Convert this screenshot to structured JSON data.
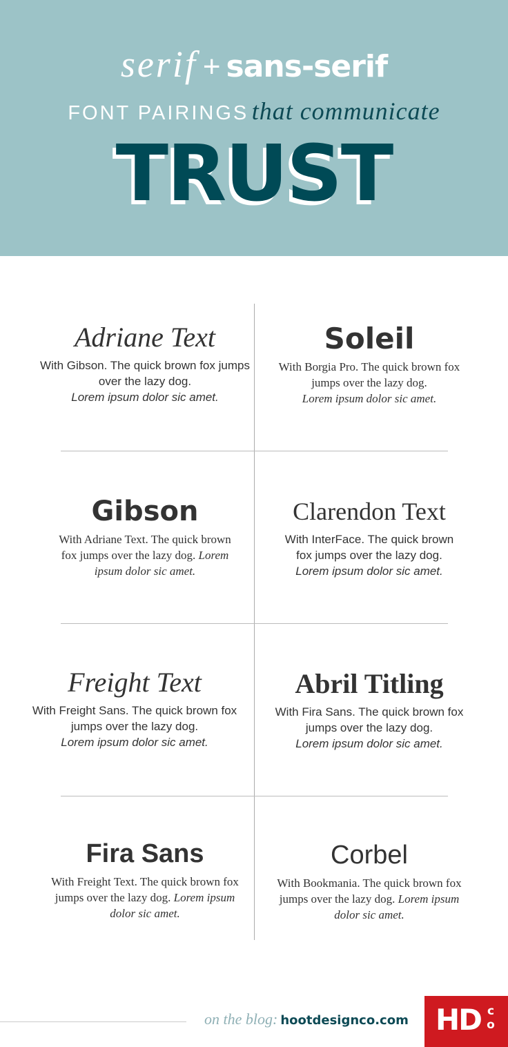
{
  "header": {
    "serif_word": "serif",
    "plus": "+",
    "sans_word": "sans-serif",
    "caps": "FONT PAIRINGS",
    "italic": "that communicate",
    "big": "TRUST"
  },
  "pairings": [
    {
      "title": "Adriane Text",
      "desc": "With Gibson. The quick brown fox jumps over the lazy dog.",
      "lorem": "Lorem ipsum dolor sic amet."
    },
    {
      "title": "Soleil",
      "desc": "With Borgia Pro. The quick brown fox jumps over the lazy dog.",
      "lorem": "Lorem ipsum dolor sic amet."
    },
    {
      "title": "Gibson",
      "desc": "With Adriane Text. The quick brown fox jumps over the lazy dog.",
      "lorem": "Lorem ipsum dolor sic amet."
    },
    {
      "title": "Clarendon Text",
      "desc": "With InterFace. The quick brown fox jumps over the lazy dog.",
      "lorem": "Lorem ipsum dolor sic amet."
    },
    {
      "title": "Freight Text",
      "desc": "With Freight Sans. The quick brown fox jumps over the lazy dog.",
      "lorem": "Lorem ipsum dolor sic amet."
    },
    {
      "title": "Abril Titling",
      "desc": "With Fira Sans. The quick brown fox jumps over the lazy dog.",
      "lorem": "Lorem ipsum dolor sic amet."
    },
    {
      "title": "Fira Sans",
      "desc": "With Freight Text. The quick brown fox jumps over the lazy dog.",
      "lorem": "Lorem ipsum dolor sic amet."
    },
    {
      "title": "Corbel",
      "desc": "With Bookmania. The quick brown fox jumps over the lazy dog.",
      "lorem": "Lorem ipsum dolor sic amet."
    }
  ],
  "footer": {
    "on_blog": "on the blog:",
    "url": "hootdesignco.com",
    "logo_text": "HDCO"
  },
  "colors": {
    "hero_bg": "#9cc3c7",
    "teal_dark": "#004a56",
    "logo_red": "#cf1a20"
  }
}
